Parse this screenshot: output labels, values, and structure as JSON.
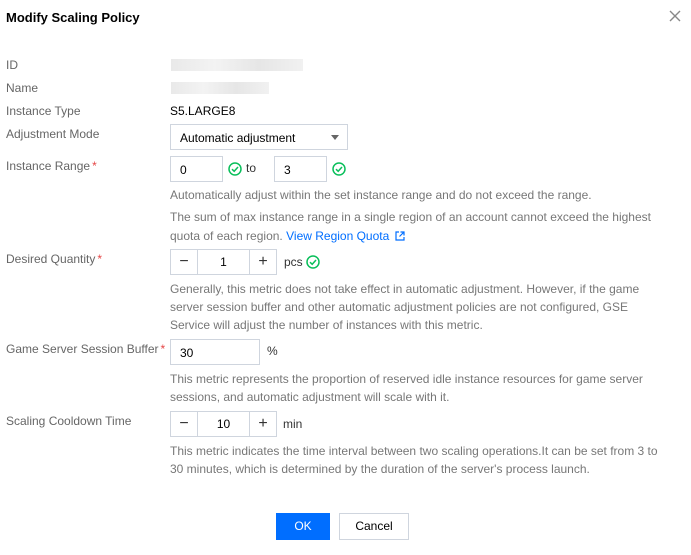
{
  "dialog": {
    "title": "Modify Scaling Policy",
    "close_icon": "close-icon"
  },
  "fields": {
    "id_label": "ID",
    "name_label": "Name",
    "instance_type_label": "Instance Type",
    "instance_type_value": "S5.LARGE8",
    "adjustment_mode_label": "Adjustment Mode",
    "adjustment_mode_value": "Automatic adjustment",
    "instance_range_label": "Instance Range",
    "instance_range_min": "0",
    "instance_range_to": "to",
    "instance_range_max": "3",
    "instance_range_help_1": "Automatically adjust within the set instance range and do not exceed the range.",
    "instance_range_help_2a": "The sum of max instance range in a single region of an account cannot exceed the highest",
    "instance_range_help_2b": "quota of each region.",
    "view_region_quota_link": "View Region Quota",
    "desired_quantity_label": "Desired Quantity",
    "desired_quantity_value": "1",
    "desired_quantity_unit": "pcs",
    "desired_quantity_help_1": "Generally, this metric does not take effect in automatic adjustment. However, if the game",
    "desired_quantity_help_2": "server session buffer and other automatic adjustment policies are not configured, GSE",
    "desired_quantity_help_3": "Service will adjust the number of instances with this metric.",
    "session_buffer_label": "Game Server Session Buffer",
    "session_buffer_value": "30",
    "session_buffer_unit": "%",
    "session_buffer_help_1": "This metric represents the proportion of reserved idle instance resources for game server",
    "session_buffer_help_2": "sessions, and automatic adjustment will scale with it.",
    "cooldown_label": "Scaling Cooldown Time",
    "cooldown_value": "10",
    "cooldown_unit": "min",
    "cooldown_help_1": "This metric indicates the time interval between two scaling operations.It can be set from 3 to",
    "cooldown_help_2": "30 minutes, which is determined by the duration of the server's process launch.",
    "required_mark": "*",
    "minus": "−",
    "plus": "+"
  },
  "footer": {
    "ok_label": "OK",
    "cancel_label": "Cancel"
  },
  "colors": {
    "primary": "#006eff",
    "required": "#e54545",
    "valid": "#0abf5b"
  }
}
